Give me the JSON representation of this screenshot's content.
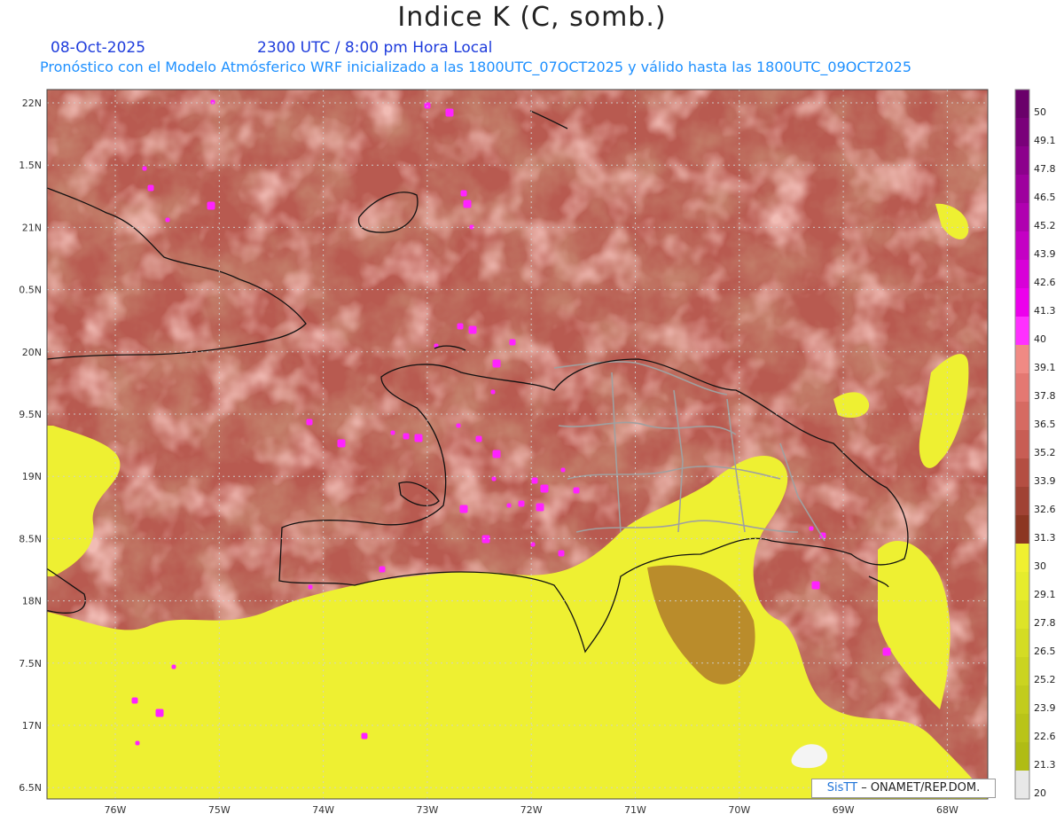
{
  "header": {
    "title": "Indice K (C, somb.)",
    "date": "08-Oct-2025",
    "time": "2300 UTC / 8:00 pm Hora Local",
    "model_line": "Pronóstico con el Modelo Atmósferico WRF inicializado a las 1800UTC_07OCT2025 y válido hasta las  1800UTC_09OCT2025",
    "date_color": "#1e3cdc",
    "model_color": "#1e90ff"
  },
  "map": {
    "lon_labels": [
      "76W",
      "75W",
      "74W",
      "73W",
      "72W",
      "71W",
      "70W",
      "69W",
      "68W"
    ],
    "lat_labels": [
      "22N",
      "1.5N",
      "21N",
      "0.5N",
      "20N",
      "9.5N",
      "19N",
      "8.5N",
      "18N",
      "7.5N",
      "17N",
      "6.5N"
    ],
    "colors": {
      "background_k": "#b85a50",
      "dark_k": "#8f3a26",
      "light_k": "#dd7c72",
      "yellow_k": "#eef032",
      "magenta_k": "#ff22ff",
      "coast": "#111111",
      "province_border": "#a0a0a0",
      "grid": "#cccccc"
    }
  },
  "colorbar": {
    "labels": [
      "50",
      "49.1",
      "47.8",
      "46.5",
      "45.2",
      "43.9",
      "42.6",
      "41.3",
      "40",
      "39.1",
      "37.8",
      "36.5",
      "35.2",
      "33.9",
      "32.6",
      "31.3",
      "30",
      "29.1",
      "27.8",
      "26.5",
      "25.2",
      "23.9",
      "22.6",
      "21.3",
      "20"
    ],
    "colors": [
      "#6a006a",
      "#7a007a",
      "#8c008c",
      "#9e009e",
      "#b000b0",
      "#c400c4",
      "#d800d8",
      "#ec00ec",
      "#ff30ff",
      "#f08a84",
      "#e47872",
      "#d66a62",
      "#c85d54",
      "#b44e42",
      "#a04234",
      "#8c3622",
      "#f0f030",
      "#e6ec2c",
      "#dde428",
      "#d4dc24",
      "#cbd420",
      "#c2cc1c",
      "#b9c418",
      "#b0bc14",
      "#e8e8e8"
    ]
  },
  "credit": {
    "brand": "SisTT",
    "org": " – ONAMET/REP.DOM."
  }
}
